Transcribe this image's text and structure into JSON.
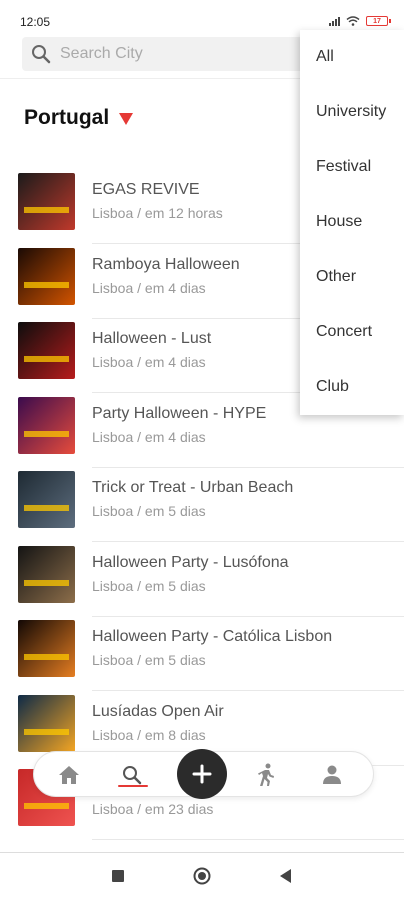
{
  "status_bar": {
    "time": "12:05",
    "battery": "17"
  },
  "search": {
    "placeholder": "Search City"
  },
  "location": {
    "country": "Portugal"
  },
  "events": [
    {
      "title": "EGAS REVIVE",
      "subtitle": "Lisboa / em 12 horas",
      "thumb_colors": [
        "#1b1b1b",
        "#c0392b"
      ]
    },
    {
      "title": "Ramboya Halloween",
      "subtitle": "Lisboa / em 4 dias",
      "thumb_colors": [
        "#1a0a05",
        "#d35400"
      ]
    },
    {
      "title": "Halloween - Lust",
      "subtitle": "Lisboa / em 4 dias",
      "thumb_colors": [
        "#0d0d0d",
        "#b71c1c"
      ]
    },
    {
      "title": "Party Halloween - HYPE",
      "subtitle": "Lisboa / em 4 dias",
      "thumb_colors": [
        "#3a0b4d",
        "#e74c3c"
      ]
    },
    {
      "title": "Trick or Treat - Urban Beach",
      "subtitle": "Lisboa / em 5 dias",
      "thumb_colors": [
        "#1e2a33",
        "#5d6d7e"
      ]
    },
    {
      "title": "Halloween Party - Lusófona",
      "subtitle": "Lisboa / em 5 dias",
      "thumb_colors": [
        "#141414",
        "#8d6e4a"
      ]
    },
    {
      "title": "Halloween Party - Católica Lisbon",
      "subtitle": "Lisboa / em 5 dias",
      "thumb_colors": [
        "#120805",
        "#e67e22"
      ]
    },
    {
      "title": "Lusíadas Open Air",
      "subtitle": "Lisboa / em 8 dias",
      "thumb_colors": [
        "#0e2a47",
        "#f5a623"
      ]
    },
    {
      "title": "",
      "subtitle": "Lisboa / em 23 dias",
      "thumb_colors": [
        "#c62828",
        "#ef5350"
      ]
    }
  ],
  "filter_menu": {
    "options": [
      "All",
      "University",
      "Festival",
      "House",
      "Other",
      "Concert",
      "Club"
    ]
  },
  "bottom_nav": {
    "items": [
      "home-icon",
      "search-icon",
      "add-icon",
      "activity-icon",
      "profile-icon"
    ],
    "active": "search-icon",
    "accent_color": "#e53935"
  },
  "colors": {
    "accent": "#e53935",
    "fab": "#2b2b2b",
    "search_bg": "#f1f1f1"
  }
}
